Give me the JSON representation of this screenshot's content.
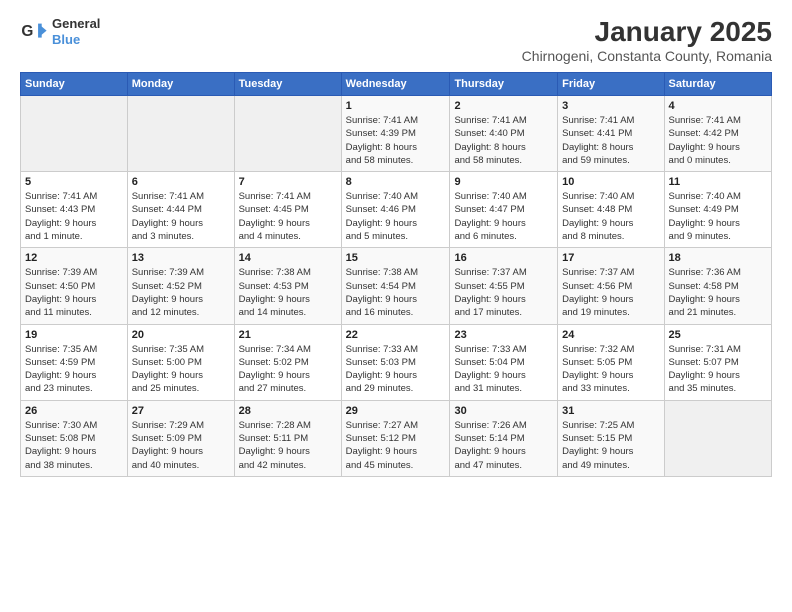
{
  "header": {
    "logo_line1": "General",
    "logo_line2": "Blue",
    "title": "January 2025",
    "subtitle": "Chirnogeni, Constanta County, Romania"
  },
  "days_of_week": [
    "Sunday",
    "Monday",
    "Tuesday",
    "Wednesday",
    "Thursday",
    "Friday",
    "Saturday"
  ],
  "weeks": [
    [
      {
        "day": "",
        "info": ""
      },
      {
        "day": "",
        "info": ""
      },
      {
        "day": "",
        "info": ""
      },
      {
        "day": "1",
        "info": "Sunrise: 7:41 AM\nSunset: 4:39 PM\nDaylight: 8 hours\nand 58 minutes."
      },
      {
        "day": "2",
        "info": "Sunrise: 7:41 AM\nSunset: 4:40 PM\nDaylight: 8 hours\nand 58 minutes."
      },
      {
        "day": "3",
        "info": "Sunrise: 7:41 AM\nSunset: 4:41 PM\nDaylight: 8 hours\nand 59 minutes."
      },
      {
        "day": "4",
        "info": "Sunrise: 7:41 AM\nSunset: 4:42 PM\nDaylight: 9 hours\nand 0 minutes."
      }
    ],
    [
      {
        "day": "5",
        "info": "Sunrise: 7:41 AM\nSunset: 4:43 PM\nDaylight: 9 hours\nand 1 minute."
      },
      {
        "day": "6",
        "info": "Sunrise: 7:41 AM\nSunset: 4:44 PM\nDaylight: 9 hours\nand 3 minutes."
      },
      {
        "day": "7",
        "info": "Sunrise: 7:41 AM\nSunset: 4:45 PM\nDaylight: 9 hours\nand 4 minutes."
      },
      {
        "day": "8",
        "info": "Sunrise: 7:40 AM\nSunset: 4:46 PM\nDaylight: 9 hours\nand 5 minutes."
      },
      {
        "day": "9",
        "info": "Sunrise: 7:40 AM\nSunset: 4:47 PM\nDaylight: 9 hours\nand 6 minutes."
      },
      {
        "day": "10",
        "info": "Sunrise: 7:40 AM\nSunset: 4:48 PM\nDaylight: 9 hours\nand 8 minutes."
      },
      {
        "day": "11",
        "info": "Sunrise: 7:40 AM\nSunset: 4:49 PM\nDaylight: 9 hours\nand 9 minutes."
      }
    ],
    [
      {
        "day": "12",
        "info": "Sunrise: 7:39 AM\nSunset: 4:50 PM\nDaylight: 9 hours\nand 11 minutes."
      },
      {
        "day": "13",
        "info": "Sunrise: 7:39 AM\nSunset: 4:52 PM\nDaylight: 9 hours\nand 12 minutes."
      },
      {
        "day": "14",
        "info": "Sunrise: 7:38 AM\nSunset: 4:53 PM\nDaylight: 9 hours\nand 14 minutes."
      },
      {
        "day": "15",
        "info": "Sunrise: 7:38 AM\nSunset: 4:54 PM\nDaylight: 9 hours\nand 16 minutes."
      },
      {
        "day": "16",
        "info": "Sunrise: 7:37 AM\nSunset: 4:55 PM\nDaylight: 9 hours\nand 17 minutes."
      },
      {
        "day": "17",
        "info": "Sunrise: 7:37 AM\nSunset: 4:56 PM\nDaylight: 9 hours\nand 19 minutes."
      },
      {
        "day": "18",
        "info": "Sunrise: 7:36 AM\nSunset: 4:58 PM\nDaylight: 9 hours\nand 21 minutes."
      }
    ],
    [
      {
        "day": "19",
        "info": "Sunrise: 7:35 AM\nSunset: 4:59 PM\nDaylight: 9 hours\nand 23 minutes."
      },
      {
        "day": "20",
        "info": "Sunrise: 7:35 AM\nSunset: 5:00 PM\nDaylight: 9 hours\nand 25 minutes."
      },
      {
        "day": "21",
        "info": "Sunrise: 7:34 AM\nSunset: 5:02 PM\nDaylight: 9 hours\nand 27 minutes."
      },
      {
        "day": "22",
        "info": "Sunrise: 7:33 AM\nSunset: 5:03 PM\nDaylight: 9 hours\nand 29 minutes."
      },
      {
        "day": "23",
        "info": "Sunrise: 7:33 AM\nSunset: 5:04 PM\nDaylight: 9 hours\nand 31 minutes."
      },
      {
        "day": "24",
        "info": "Sunrise: 7:32 AM\nSunset: 5:05 PM\nDaylight: 9 hours\nand 33 minutes."
      },
      {
        "day": "25",
        "info": "Sunrise: 7:31 AM\nSunset: 5:07 PM\nDaylight: 9 hours\nand 35 minutes."
      }
    ],
    [
      {
        "day": "26",
        "info": "Sunrise: 7:30 AM\nSunset: 5:08 PM\nDaylight: 9 hours\nand 38 minutes."
      },
      {
        "day": "27",
        "info": "Sunrise: 7:29 AM\nSunset: 5:09 PM\nDaylight: 9 hours\nand 40 minutes."
      },
      {
        "day": "28",
        "info": "Sunrise: 7:28 AM\nSunset: 5:11 PM\nDaylight: 9 hours\nand 42 minutes."
      },
      {
        "day": "29",
        "info": "Sunrise: 7:27 AM\nSunset: 5:12 PM\nDaylight: 9 hours\nand 45 minutes."
      },
      {
        "day": "30",
        "info": "Sunrise: 7:26 AM\nSunset: 5:14 PM\nDaylight: 9 hours\nand 47 minutes."
      },
      {
        "day": "31",
        "info": "Sunrise: 7:25 AM\nSunset: 5:15 PM\nDaylight: 9 hours\nand 49 minutes."
      },
      {
        "day": "",
        "info": ""
      }
    ]
  ]
}
